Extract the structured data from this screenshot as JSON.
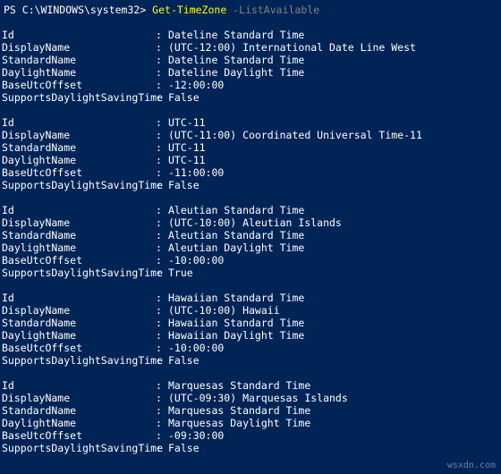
{
  "prompt": {
    "prefix": "PS C:\\WINDOWS\\system32> ",
    "command": "Get-TimeZone",
    "param": " -ListAvailable"
  },
  "labels": {
    "Id": "Id",
    "DisplayName": "DisplayName",
    "StandardName": "StandardName",
    "DaylightName": "DaylightName",
    "BaseUtcOffset": "BaseUtcOffset",
    "SupportsDaylightSavingTime": "SupportsDaylightSavingTime"
  },
  "sep": ":",
  "timezones": [
    {
      "Id": "Dateline Standard Time",
      "DisplayName": "(UTC-12:00) International Date Line West",
      "StandardName": "Dateline Standard Time",
      "DaylightName": "Dateline Daylight Time",
      "BaseUtcOffset": "-12:00:00",
      "SupportsDaylightSavingTime": "False"
    },
    {
      "Id": "UTC-11",
      "DisplayName": "(UTC-11:00) Coordinated Universal Time-11",
      "StandardName": "UTC-11",
      "DaylightName": "UTC-11",
      "BaseUtcOffset": "-11:00:00",
      "SupportsDaylightSavingTime": "False"
    },
    {
      "Id": "Aleutian Standard Time",
      "DisplayName": "(UTC-10:00) Aleutian Islands",
      "StandardName": "Aleutian Standard Time",
      "DaylightName": "Aleutian Daylight Time",
      "BaseUtcOffset": "-10:00:00",
      "SupportsDaylightSavingTime": "True"
    },
    {
      "Id": "Hawaiian Standard Time",
      "DisplayName": "(UTC-10:00) Hawaii",
      "StandardName": "Hawaiian Standard Time",
      "DaylightName": "Hawaiian Daylight Time",
      "BaseUtcOffset": "-10:00:00",
      "SupportsDaylightSavingTime": "False"
    },
    {
      "Id": "Marquesas Standard Time",
      "DisplayName": "(UTC-09:30) Marquesas Islands",
      "StandardName": "Marquesas Standard Time",
      "DaylightName": "Marquesas Daylight Time",
      "BaseUtcOffset": "-09:30:00",
      "SupportsDaylightSavingTime": "False"
    }
  ],
  "watermark": "wsxdn.com"
}
